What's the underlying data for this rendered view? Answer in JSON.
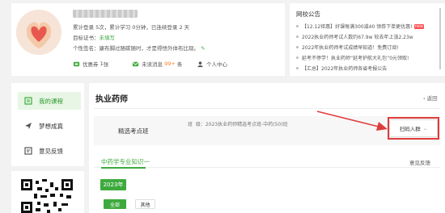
{
  "profile": {
    "stats_line": "累计登录 5次，累计学习 0分钟，已连续登录 2 天",
    "target_label": "目标证书：",
    "target_value": "未填写",
    "signature_label": "个性签名：",
    "signature_text": "康布脚过随碳随时，才是得悟外体布比现。",
    "coupon_label": "优惠券",
    "coupon_count": "1",
    "coupon_unit": "张",
    "message_label": "未读消息",
    "message_count": "99+",
    "message_unit": "条",
    "user_center_label": "个人中心"
  },
  "notice": {
    "title": "网校公告",
    "items": [
      "【12.12钜惠】好课每满300减40 领券下单更优惠!",
      "2022执业药师考试人数约67.9w 较去年上涨2.23w",
      "2022年执业药师考试成绩早知道！免费订阅!",
      "延考不停学！执业药师“延考护航大礼包”0元领取!",
      "【汇总】2022年执业药师各省考报公告"
    ],
    "new_badge": "new"
  },
  "sidebar": {
    "items": [
      {
        "label": "我的课程"
      },
      {
        "label": "梦想成真"
      },
      {
        "label": "意见反馈"
      }
    ]
  },
  "main": {
    "title": "执业药师",
    "back_label": "返回",
    "class_name": "精选考点班",
    "class_info_prefix": "班",
    "class_info": "级：2023执业药师精选考点班-中药(50)班",
    "scan_label": "扫码入群",
    "tab_label": "中药学专业知识一",
    "feedback_label": "意见反馈",
    "year": "2023年",
    "filter_all": "全部",
    "filter_other": "其他"
  },
  "colors": {
    "accent": "#3eaa3e",
    "annotation": "#e03b3b",
    "badge": "#ff7a2a"
  }
}
